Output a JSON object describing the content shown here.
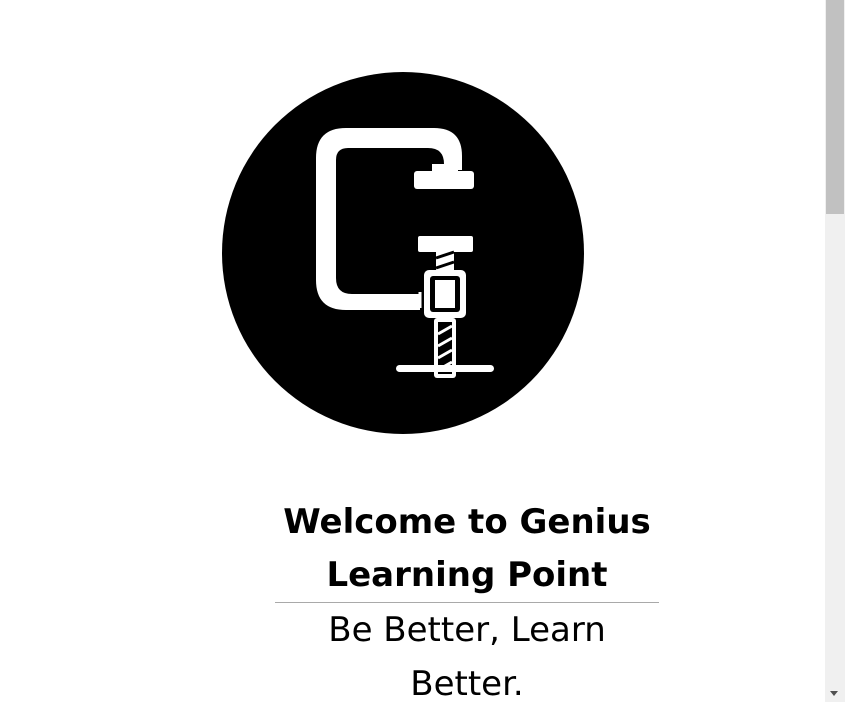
{
  "hero": {
    "logo_icon": "clamp-g-logo-icon",
    "title": "Welcome to Genius Learning Point",
    "tagline": "Be Better, Learn Better."
  },
  "scrollbar": {
    "down_arrow_icon": "chevron-down-icon"
  }
}
